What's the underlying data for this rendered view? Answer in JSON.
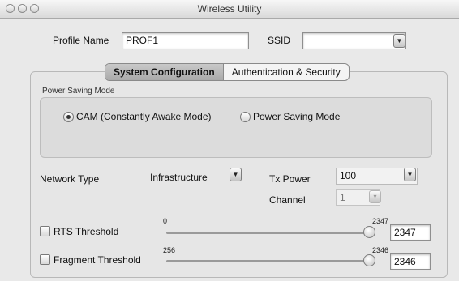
{
  "window": {
    "title": "Wireless Utility"
  },
  "profile": {
    "label": "Profile Name",
    "value": "PROF1"
  },
  "ssid": {
    "label": "SSID",
    "value": ""
  },
  "tabs": [
    {
      "label": "System Configuration",
      "active": true
    },
    {
      "label": "Authentication & Security",
      "active": false
    }
  ],
  "power_saving": {
    "group_label": "Power Saving Mode",
    "options": [
      {
        "label": "CAM (Constantly Awake Mode)",
        "selected": true
      },
      {
        "label": "Power Saving Mode",
        "selected": false
      }
    ]
  },
  "network_type": {
    "label": "Network Type",
    "value": "Infrastructure"
  },
  "tx_power": {
    "label": "Tx Power",
    "value": "100"
  },
  "channel": {
    "label": "Channel",
    "value": "1"
  },
  "rts": {
    "label": "RTS Threshold",
    "checked": false,
    "min": "0",
    "max": "2347",
    "value": "2347"
  },
  "fragment": {
    "label": "Fragment Threshold",
    "checked": false,
    "min": "256",
    "max": "2346",
    "value": "2346"
  },
  "icons": {
    "dropdown": "chevron-down-icon",
    "stepper": "stepper-icon"
  }
}
